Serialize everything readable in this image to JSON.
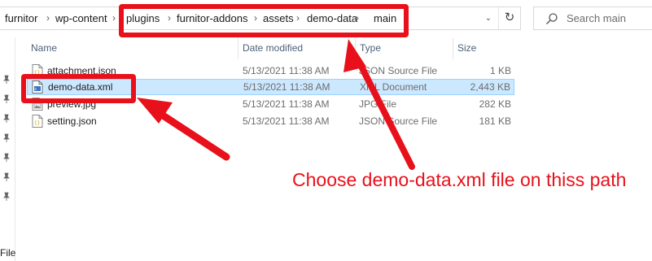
{
  "address_bar": {
    "crumbs": [
      "furnitor",
      "wp-content",
      "plugins",
      "furnitor-addons",
      "assets",
      "demo-data",
      "main"
    ],
    "separator": "›",
    "dropdown_glyph": "⌄",
    "refresh_glyph": "↻"
  },
  "search": {
    "placeholder": "Search main",
    "icon": "search-icon"
  },
  "columns": {
    "name": "Name",
    "date": "Date modified",
    "type": "Type",
    "size": "Size"
  },
  "files": [
    {
      "name": "attachment.json",
      "date": "5/13/2021 11:38 AM",
      "type": "JSON Source File",
      "size": "1 KB",
      "icon": "json-file-icon"
    },
    {
      "name": "demo-data.xml",
      "date": "5/13/2021 11:38 AM",
      "type": "XML Document",
      "size": "2,443 KB",
      "icon": "xml-file-icon",
      "selected": true
    },
    {
      "name": "preview.jpg",
      "date": "5/13/2021 11:38 AM",
      "type": "JPG File",
      "size": "282 KB",
      "icon": "image-file-icon"
    },
    {
      "name": "setting.json",
      "date": "5/13/2021 11:38 AM",
      "type": "JSON Source File",
      "size": "181 KB",
      "icon": "json-file-icon"
    }
  ],
  "nav": {
    "label": "File"
  },
  "annotation": {
    "caption": "Choose demo-data.xml file on thiss path",
    "color": "#e8101a"
  },
  "colors": {
    "selection_bg": "#cce8ff",
    "selection_border": "#99d1ff",
    "header_text": "#4c607a"
  }
}
